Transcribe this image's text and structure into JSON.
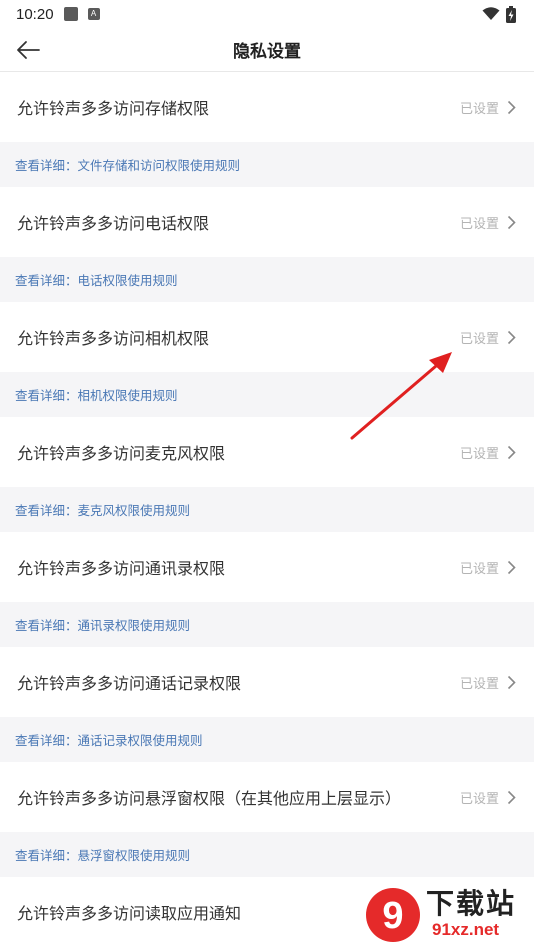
{
  "status_bar": {
    "time": "10:20"
  },
  "header": {
    "title": "隐私设置"
  },
  "permissions": [
    {
      "label": "允许铃声多多访问存储权限",
      "status": "已设置",
      "detail": "查看详细：文件存储和访问权限使用规则"
    },
    {
      "label": "允许铃声多多访问电话权限",
      "status": "已设置",
      "detail": "查看详细：电话权限使用规则"
    },
    {
      "label": "允许铃声多多访问相机权限",
      "status": "已设置",
      "detail": "查看详细：相机权限使用规则"
    },
    {
      "label": "允许铃声多多访问麦克风权限",
      "status": "已设置",
      "detail": "查看详细：麦克风权限使用规则"
    },
    {
      "label": "允许铃声多多访问通讯录权限",
      "status": "已设置",
      "detail": "查看详细：通讯录权限使用规则"
    },
    {
      "label": "允许铃声多多访问通话记录权限",
      "status": "已设置",
      "detail": "查看详细：通话记录权限使用规则"
    },
    {
      "label": "允许铃声多多访问悬浮窗权限（在其他应用上层显示）",
      "status": "已设置",
      "detail": "查看详细：悬浮窗权限使用规则"
    },
    {
      "label": "允许铃声多多访问读取应用通知"
    }
  ],
  "watermark": {
    "title": "下载站",
    "url": "91xz.net",
    "logo_text": "9"
  },
  "colors": {
    "link": "#4a78b5",
    "status_gray": "#b4b4b4",
    "detail_bg": "#f5f5f7",
    "annotation_arrow": "#e02020",
    "watermark_red": "#e52a2a"
  }
}
